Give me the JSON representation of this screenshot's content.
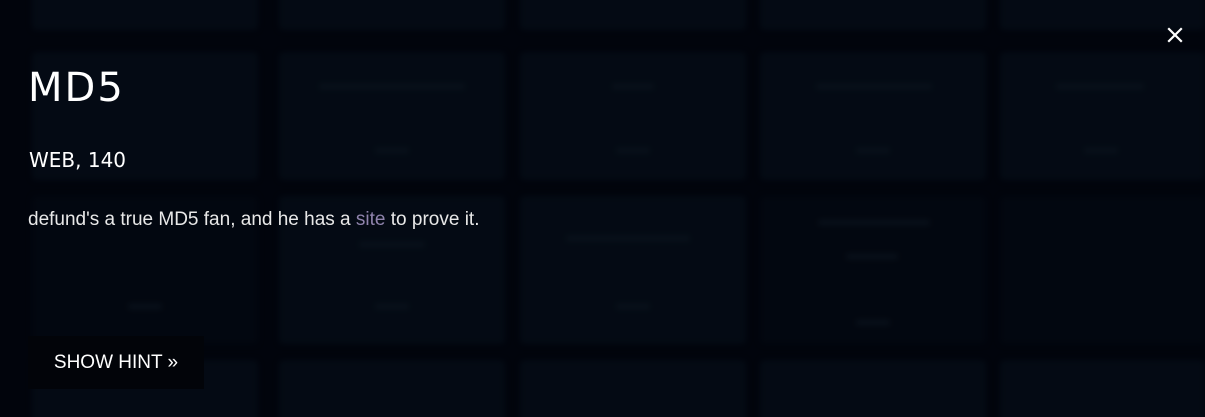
{
  "challenge": {
    "title": "MD5",
    "category_points": "WEB, 140",
    "description_before": "defund's a true MD5 fan, and he has a ",
    "description_link": "site",
    "description_after": " to prove it.",
    "hint_button_label": "SHOW HINT »"
  },
  "icons": {
    "close": "close-icon"
  },
  "colors": {
    "background": "#040913",
    "text": "#ffffff",
    "link": "#8f83ac",
    "hint_button_bg": "#020409"
  }
}
